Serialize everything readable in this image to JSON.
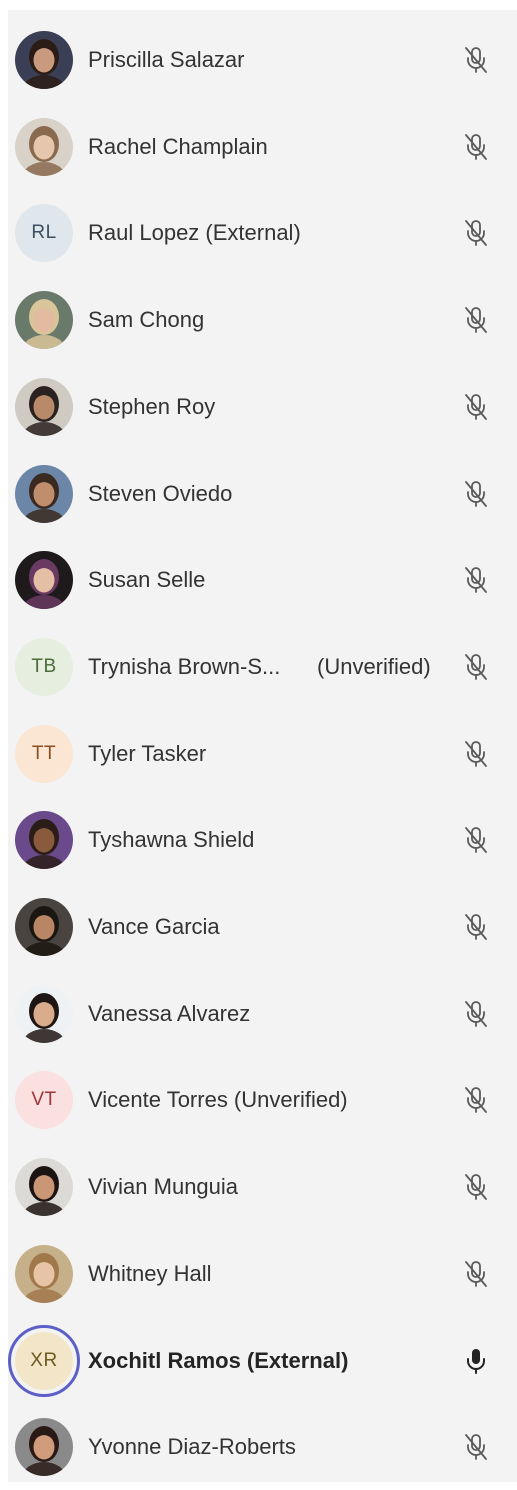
{
  "participants": [
    {
      "name": "Priscilla Salazar",
      "tag": "",
      "avatar": "photo",
      "skin": "#c99a7e",
      "hair": "#2b1d16",
      "bg": "#3a3f55",
      "mic": "muted-mic-icon"
    },
    {
      "name": "Rachel Champlain",
      "tag": "",
      "avatar": "photo",
      "skin": "#e6c6ad",
      "hair": "#8a6a4e",
      "bg": "#d8d2c8",
      "mic": "muted-mic-icon"
    },
    {
      "name": "Raul Lopez (External)",
      "tag": "",
      "avatar": "initials",
      "initials": "RL",
      "bg": "#dfe6ec",
      "fg": "#3c4f60",
      "mic": "muted-mic-icon"
    },
    {
      "name": "Sam Chong",
      "tag": "",
      "avatar": "photo",
      "skin": "#e2bba0",
      "hair": "#d9c59a",
      "bg": "#6a7a6a",
      "mic": "muted-mic-icon"
    },
    {
      "name": "Stephen Roy",
      "tag": "",
      "avatar": "photo",
      "skin": "#b98a6a",
      "hair": "#2a2220",
      "bg": "#cfcac2",
      "mic": "muted-mic-icon"
    },
    {
      "name": "Steven Oviedo",
      "tag": "",
      "avatar": "photo",
      "skin": "#c08e6c",
      "hair": "#3a2a20",
      "bg": "#6c86a8",
      "mic": "muted-mic-icon"
    },
    {
      "name": "Susan Selle",
      "tag": "",
      "avatar": "photo",
      "skin": "#e4bfa6",
      "hair": "#6a3a62",
      "bg": "#1e1a1c",
      "mic": "muted-mic-icon"
    },
    {
      "name": "Trynisha Brown-S...",
      "tag": "(Unverified)",
      "avatar": "initials",
      "initials": "TB",
      "bg": "#e6eedf",
      "fg": "#4a6b3a",
      "mic": "muted-mic-icon"
    },
    {
      "name": "Tyler Tasker",
      "tag": "",
      "avatar": "initials",
      "initials": "TT",
      "bg": "#fbe5d3",
      "fg": "#8c4f22",
      "mic": "muted-mic-icon"
    },
    {
      "name": "Tyshawna Shield",
      "tag": "",
      "avatar": "photo",
      "skin": "#8a5a3c",
      "hair": "#2a1c16",
      "bg": "#6a4a8a",
      "mic": "muted-mic-icon"
    },
    {
      "name": "Vance Garcia",
      "tag": "",
      "avatar": "photo",
      "skin": "#b88664",
      "hair": "#1c1612",
      "bg": "#4a4440",
      "mic": "muted-mic-icon"
    },
    {
      "name": "Vanessa Alvarez",
      "tag": "",
      "avatar": "photo",
      "skin": "#d8ac8c",
      "hair": "#1e1614",
      "bg": "#eef2f4",
      "mic": "muted-mic-icon"
    },
    {
      "name": "Vicente Torres (Unverified)",
      "tag": "",
      "avatar": "initials",
      "initials": "VT",
      "bg": "#fbe0e0",
      "fg": "#9a3838",
      "mic": "muted-mic-icon"
    },
    {
      "name": "Vivian Munguia",
      "tag": "",
      "avatar": "photo",
      "skin": "#c99676",
      "hair": "#1c1412",
      "bg": "#dcdad6",
      "mic": "muted-mic-icon"
    },
    {
      "name": "Whitney Hall",
      "tag": "",
      "avatar": "photo",
      "skin": "#e8c4a6",
      "hair": "#a0784a",
      "bg": "#c6b08a",
      "mic": "muted-mic-icon"
    },
    {
      "name": "Xochitl Ramos (External)",
      "tag": "",
      "avatar": "initials",
      "initials": "XR",
      "bg": "#f3e6c8",
      "fg": "#6e5a22",
      "mic": "mic-icon",
      "speaking": true,
      "ring": "#5b5fc7"
    },
    {
      "name": "Yvonne Diaz-Roberts",
      "tag": "",
      "avatar": "photo",
      "skin": "#d09c7c",
      "hair": "#2a1a16",
      "bg": "#8a8a8a",
      "mic": "muted-mic-icon"
    }
  ]
}
